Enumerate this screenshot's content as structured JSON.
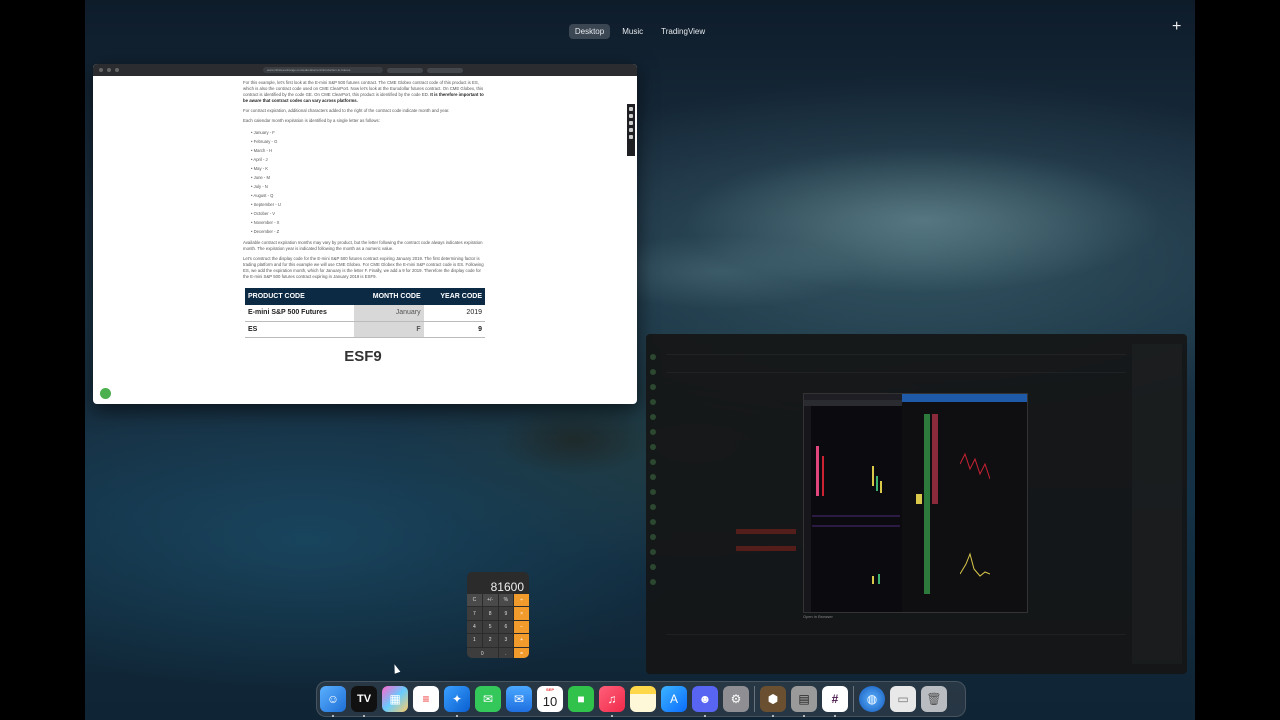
{
  "spaces": {
    "tabs": [
      {
        "label": "Desktop",
        "active": true
      },
      {
        "label": "Music",
        "active": false
      },
      {
        "label": "TradingView",
        "active": false
      }
    ],
    "add_label": "+"
  },
  "browser": {
    "url": "www.infiniteexchange.com/education/en/introduction-to-futures",
    "intro_text": "For this example, let's first look at the E-mini S&P 500 futures contract. The CME Globex contract code of this product is ES, which is also the contract code used on CME ClearPort. Now let's look at the Eurodollar futures contract. On CME Globex, this contract is identified by the code GE. On CME ClearPort, this product is identified by the code ED.",
    "intro_bold": "It is therefore important to be aware that contract codes can vary across platforms.",
    "expiry_text": "For contract expiration, additional characters added to the right of the contract code indicate month and year.",
    "month_text": "Each calendar month expiration is identified by a single letter as follows:",
    "months": [
      "January - F",
      "February - G",
      "March - H",
      "April - J",
      "May - K",
      "June - M",
      "July - N",
      "August - Q",
      "September - U",
      "October - V",
      "November - X",
      "December - Z"
    ],
    "available_text": "Available contract expiration months may vary by product, but the letter following the contract code always indicates expiration month. The expiration year is indicated following the month as a numeric value.",
    "construct_text": "Let's construct the display code for the E-mini S&P 500 futures contract expiring January 2019. The first determining factor is trading platform and for this example we will use CME Globex. For CME Globex the E-mini S&P contract code is ES. Following ES, we add the expiration month, which for January is the letter F. Finally, we add a 9 for 2019. Therefore the display code for the E-mini S&P 500 futures contract expiring in January 2019 is ESF9.",
    "table": {
      "headers": [
        "PRODUCT CODE",
        "MONTH CODE",
        "YEAR CODE"
      ],
      "rows": [
        [
          "E-mini S&P 500 Futures",
          "January",
          "2019"
        ],
        [
          "ES",
          "F",
          "9"
        ]
      ]
    },
    "result_code": "ESF9"
  },
  "trading": {
    "caption": "Open in Browser"
  },
  "calculator": {
    "display": "81600",
    "keys": [
      "C",
      "+/-",
      "%",
      "÷",
      "7",
      "8",
      "9",
      "×",
      "4",
      "5",
      "6",
      "−",
      "1",
      "2",
      "3",
      "+",
      "0",
      ".",
      "="
    ]
  },
  "dock": {
    "calendar_month": "SEP",
    "calendar_day": "10"
  },
  "colors": {
    "table_header": "#0d2a45",
    "calc_operator": "#f19b2c",
    "accent_green": "#4caf50"
  }
}
